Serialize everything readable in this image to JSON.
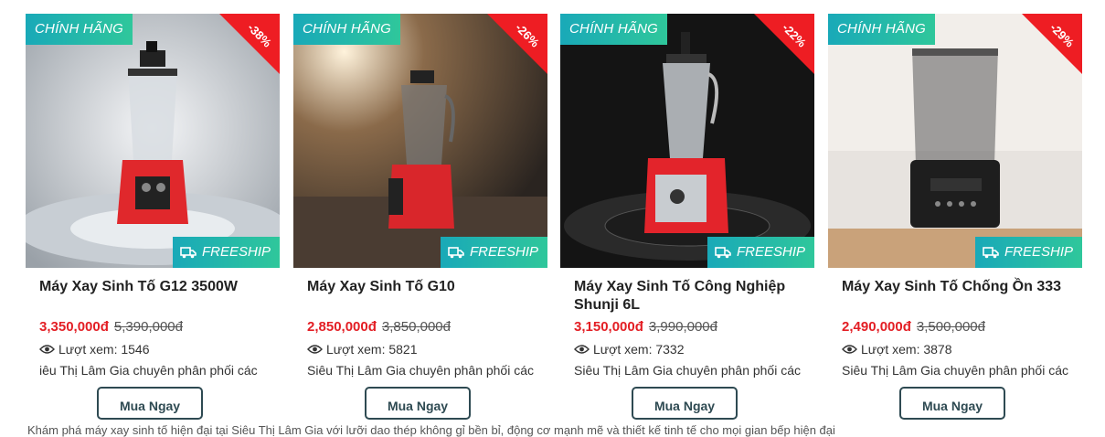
{
  "products": [
    {
      "authentic_label": "CHÍNH HÃNG",
      "discount": "-38%",
      "freeship_label": "FREESHIP",
      "name": "Máy Xay Sinh Tố G12 3500W",
      "price": "3,350,000đ",
      "old_price": "5,390,000đ",
      "views": "Lượt xem: 1546",
      "description": "iêu Thị Lâm Gia chuyên phân phối các",
      "button": "Mua Ngay",
      "body_color": "#e0282c",
      "background": "#d9dde2"
    },
    {
      "authentic_label": "CHÍNH HÃNG",
      "discount": "-26%",
      "freeship_label": "FREESHIP",
      "name": "Máy Xay Sinh Tố G10",
      "price": "2,850,000đ",
      "old_price": "3,850,000đ",
      "views": "Lượt xem: 5821",
      "description": "Siêu Thị Lâm Gia chuyên phân phối các",
      "button": "Mua Ngay",
      "body_color": "#d9262b",
      "background": "#3a3430"
    },
    {
      "authentic_label": "CHÍNH HÃNG",
      "discount": "-22%",
      "freeship_label": "FREESHIP",
      "name": "Máy Xay Sinh Tố Công Nghiệp Shunji 6L",
      "price": "3,150,000đ",
      "old_price": "3,990,000đ",
      "views": "Lượt xem: 7332",
      "description": "Siêu Thị Lâm Gia chuyên phân phối các",
      "button": "Mua Ngay",
      "body_color": "#e3242b",
      "background": "#141414"
    },
    {
      "authentic_label": "CHÍNH HÃNG",
      "discount": "-29%",
      "freeship_label": "FREESHIP",
      "name": "Máy Xay Sinh Tố Chống Ồn 333",
      "price": "2,490,000đ",
      "old_price": "3,500,000đ",
      "views": "Lượt xem: 3878",
      "description": "Siêu Thị Lâm Gia chuyên phân phối các",
      "button": "Mua Ngay",
      "body_color": "#1e1e1e",
      "background": "#e7e3df"
    }
  ],
  "footer_partial": "Khám phá máy xay sinh tố hiện đại tại Siêu Thị Lâm Gia với lưỡi dao thép không gỉ bền bỉ, động cơ mạnh mẽ và thiết kế tinh tế cho mọi gian bếp hiện đại"
}
